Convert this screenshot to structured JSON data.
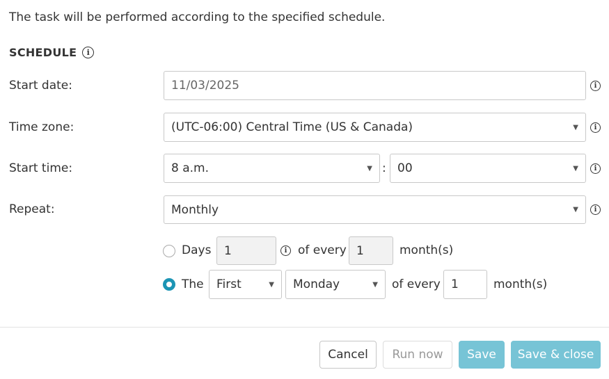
{
  "intro_text": "The task will be performed according to the specified schedule.",
  "section_title": "SCHEDULE",
  "labels": {
    "start_date": "Start date:",
    "time_zone": "Time zone:",
    "start_time": "Start time:",
    "repeat": "Repeat:"
  },
  "fields": {
    "start_date": "11/03/2025",
    "time_zone": "(UTC-06:00) Central Time (US & Canada)",
    "start_hour": "8 a.m.",
    "start_minute": "00",
    "time_separator": ":",
    "repeat": "Monthly"
  },
  "monthly": {
    "days_option": {
      "label": "Days",
      "day_value": "1",
      "of_every_label": "of every",
      "month_interval": "1",
      "months_label": "month(s)",
      "selected": false
    },
    "the_option": {
      "label": "The",
      "ordinal": "First",
      "weekday": "Monday",
      "of_every_label": "of every",
      "month_interval": "1",
      "months_label": "month(s)",
      "selected": true
    }
  },
  "buttons": {
    "cancel": "Cancel",
    "run_now": "Run now",
    "save": "Save",
    "save_close": "Save & close"
  },
  "icons": {
    "info_glyph": "i",
    "caret_glyph": "▼"
  },
  "colors": {
    "accent": "#1c95b5",
    "primary_button": "#77c4d6"
  }
}
